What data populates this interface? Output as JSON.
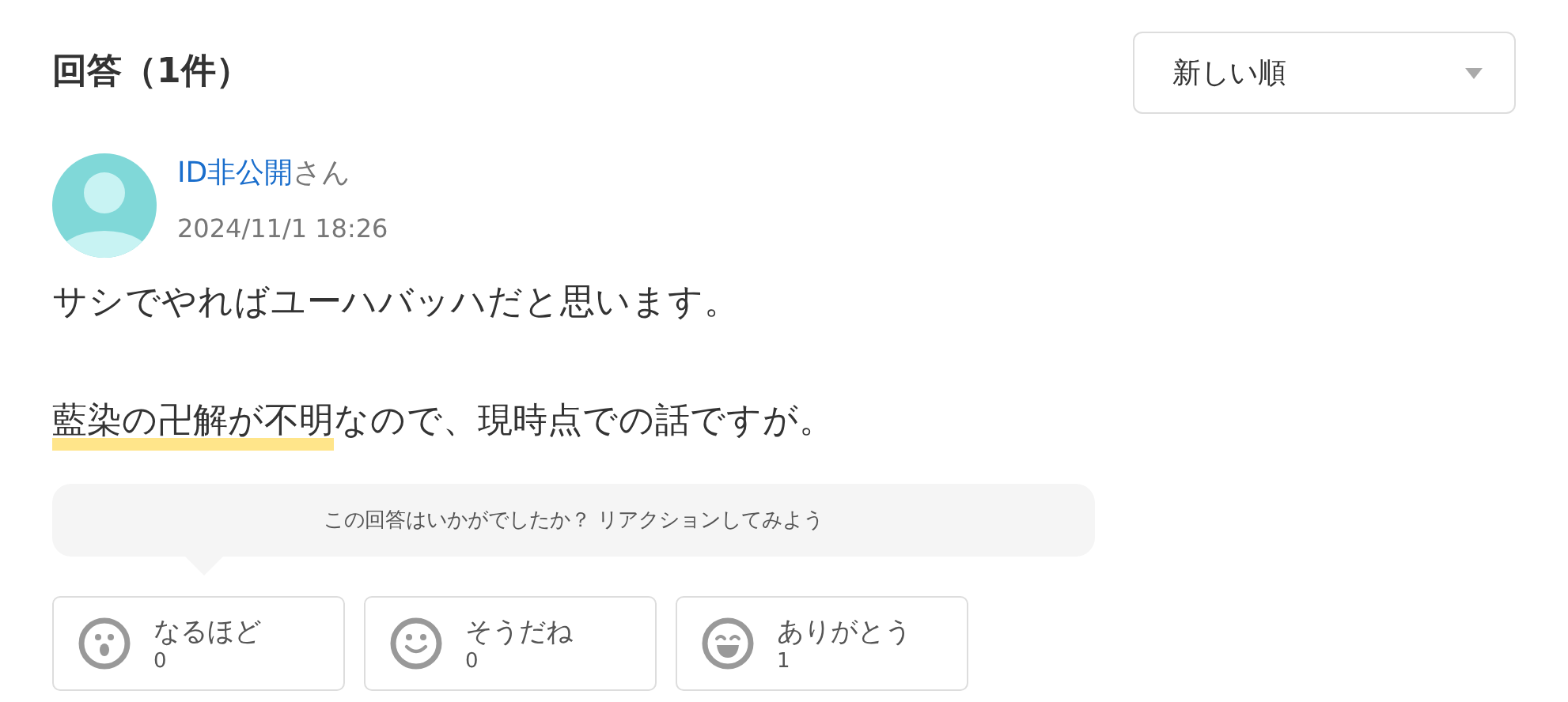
{
  "heading": "回答（1件）",
  "sort": {
    "value": "新しい順"
  },
  "answer": {
    "user": "ID非公開",
    "honorific": "さん",
    "date": "2024/11/1 18:26",
    "paragraphs": [
      [
        {
          "text": "サシでやればユーハバッハだと思います。",
          "highlighted": false
        }
      ],
      [
        {
          "text": "藍染の卍解が不明",
          "highlighted": true
        },
        {
          "text": "なので、現時点での話ですが。",
          "highlighted": false
        }
      ]
    ]
  },
  "prompt": "この回答はいかがでしたか？ リアクションしてみよう",
  "reactions": [
    {
      "kind": "surprised",
      "label": "なるほど",
      "count": "0"
    },
    {
      "kind": "smile",
      "label": "そうだね",
      "count": "0"
    },
    {
      "kind": "laugh",
      "label": "ありがとう",
      "count": "1"
    }
  ]
}
